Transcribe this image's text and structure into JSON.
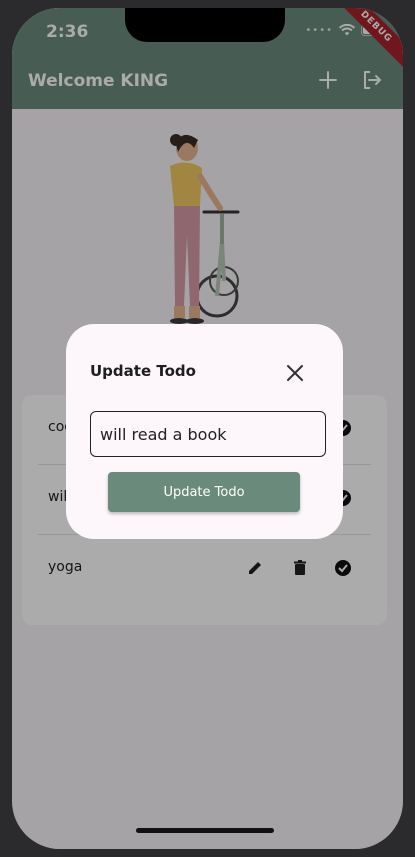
{
  "status_bar": {
    "time": "2:36"
  },
  "app_bar": {
    "title": "Welcome KING",
    "debug_banner": "DEBUG"
  },
  "todos": [
    {
      "label": "codi"
    },
    {
      "label": "will r"
    },
    {
      "label": "yoga"
    }
  ],
  "dialog": {
    "title": "Update Todo",
    "input_value": "will read a book",
    "button_label": "Update Todo"
  },
  "colors": {
    "accent": "#6a8a7b",
    "dialog_bg": "#fdf6fa",
    "debug": "#a8232c"
  },
  "icons": [
    "add-icon",
    "logout-icon",
    "edit-icon",
    "delete-icon",
    "check-circle-icon",
    "close-icon",
    "wifi-icon",
    "battery-icon"
  ]
}
